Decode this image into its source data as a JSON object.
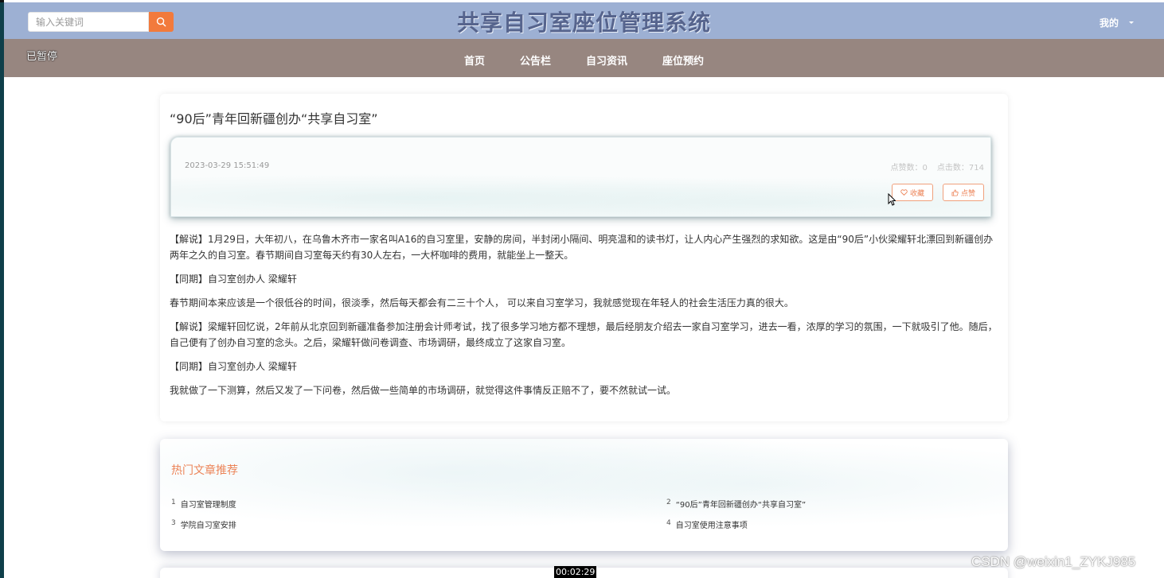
{
  "header": {
    "search_placeholder": "输入关键词",
    "site_title": "共享自习室座位管理系统",
    "user_label": "我的"
  },
  "overlay": {
    "paused_label": "已暂停",
    "timestamp": "00:02:29",
    "watermark": "CSDN @weixin1_ZYKJ985"
  },
  "nav": {
    "items": [
      {
        "label": "首页"
      },
      {
        "label": "公告栏"
      },
      {
        "label": "自习资讯"
      },
      {
        "label": "座位预约"
      }
    ]
  },
  "article": {
    "title": "“90后”青年回新疆创办“共享自习室”",
    "date": "2023-03-29 15:51:49",
    "likes_label": "点赞数：0",
    "clicks_label": "点击数：714",
    "favorite_label": "收藏",
    "like_label": "点赞",
    "paragraphs": [
      "【解说】1月29日，大年初八，在乌鲁木齐市一家名叫A16的自习室里，安静的房间，半封闭小隔间、明亮温和的读书灯，让人内心产生强烈的求知欲。这是由“90后”小伙梁耀轩北漂回到新疆创办两年之久的自习室。春节期间自习室每天约有30人左右，一大杯咖啡的费用，就能坐上一整天。",
      "【同期】自习室创办人 梁耀轩",
      "春节期间本来应该是一个很低谷的时间，很淡季，然后每天都会有二三十个人， 可以来自习室学习，我就感觉现在年轻人的社会生活压力真的很大。",
      "【解说】梁耀轩回忆说，2年前从北京回到新疆准备参加注册会计师考试，找了很多学习地方都不理想，最后经朋友介绍去一家自习室学习，进去一看，浓厚的学习的氛围，一下就吸引了他。随后，自己便有了创办自习室的念头。之后，梁耀轩做问卷调查、市场调研，最终成立了这家自习室。",
      "【同期】自习室创办人 梁耀轩",
      "我就做了一下测算，然后又发了一下问卷，然后做一些简单的市场调研，就觉得这件事情反正赔不了，要不然就试一试。"
    ]
  },
  "hot": {
    "title": "热门文章推荐",
    "items": [
      {
        "num": "1",
        "label": "自习室管理制度"
      },
      {
        "num": "2",
        "label": "“90后”青年回新疆创办“共享自习室”"
      },
      {
        "num": "3",
        "label": "学院自习室安排"
      },
      {
        "num": "4",
        "label": "自习室使用注意事项"
      }
    ]
  }
}
